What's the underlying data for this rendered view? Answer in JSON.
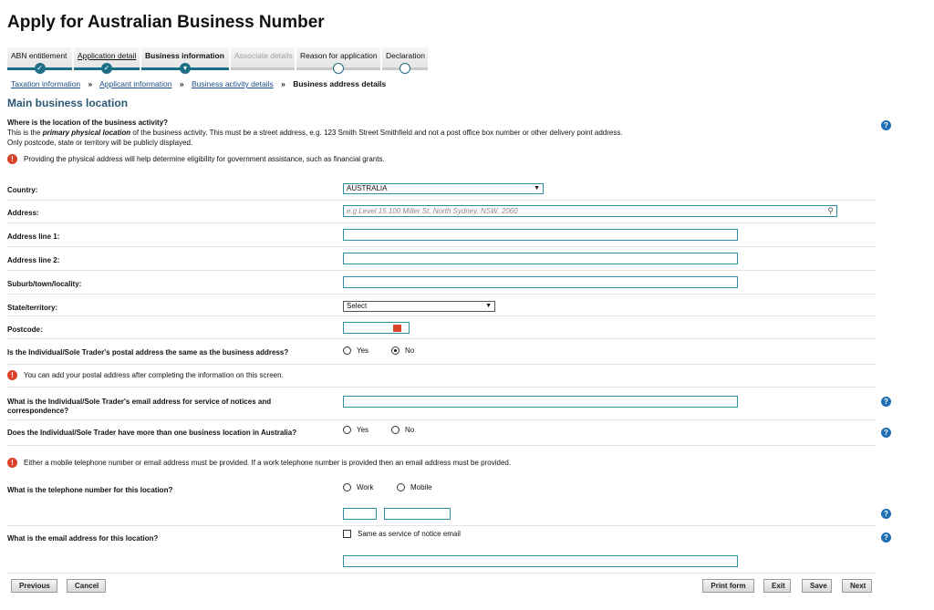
{
  "page_title": "Apply for Australian Business Number",
  "steps": [
    {
      "label": "ABN entitlement",
      "state": "complete"
    },
    {
      "label": "Application detail",
      "state": "complete"
    },
    {
      "label": "Business information",
      "state": "current"
    },
    {
      "label": "Associate details",
      "state": "disabled"
    },
    {
      "label": "Reason for application",
      "state": "pending"
    },
    {
      "label": "Declaration",
      "state": "pending"
    }
  ],
  "breadcrumb": {
    "items": [
      "Taxation information",
      "Applicant information",
      "Business activity details"
    ],
    "separator": "»",
    "current": "Business address details"
  },
  "section_heading": "Main business location",
  "intro": {
    "question": "Where is the location of the business activity?",
    "line1_pre": "This is the ",
    "line1_em": "primary physical location",
    "line1_post": " of the business activity. This must be a street address, e.g. 123 Smith Street Smithfield and not a post office box number or other delivery point address.",
    "line2": "Only postcode, state or territory will be publicly displayed."
  },
  "notices": {
    "physical_address": "Providing the physical address will help determine eligibility for government assistance, such as financial grants.",
    "postal_later": "You can add your postal address after completing the information on this screen.",
    "contact_required": "Either a mobile telephone number or email address must be provided. If a work telephone number is provided then an email address must be provided."
  },
  "fields": {
    "country": {
      "label": "Country:",
      "value": "AUSTRALIA"
    },
    "address": {
      "label": "Address:",
      "placeholder": "e.g Level 15 100 Miller St, North Sydney, NSW, 2060"
    },
    "address_line1": {
      "label": "Address line 1:",
      "value": ""
    },
    "address_line2": {
      "label": "Address line 2:",
      "value": ""
    },
    "suburb": {
      "label": "Suburb/town/locality:",
      "value": ""
    },
    "state": {
      "label": "State/territory:",
      "value": "Select"
    },
    "postcode": {
      "label": "Postcode:",
      "value": ""
    },
    "postal_same": {
      "label": "Is the Individual/Sole Trader's postal address the same as the business address?",
      "yes": "Yes",
      "no": "No",
      "selected": "No"
    },
    "notice_email": {
      "label_line1": "What is the Individual/Sole Trader's email address for service of notices and",
      "label_line2": "correspondence?",
      "value": ""
    },
    "multiple_locations": {
      "label": "Does the Individual/Sole Trader have more than one business location in Australia?",
      "yes": "Yes",
      "no": "No",
      "selected": ""
    },
    "telephone": {
      "label": "What is the telephone number for this location?",
      "work": "Work",
      "mobile": "Mobile",
      "area_code": "",
      "number": ""
    },
    "location_email": {
      "label": "What is the email address for this location?",
      "same_as_notice": "Same as service of notice email",
      "value": ""
    }
  },
  "buttons": {
    "previous": "Previous",
    "cancel": "Cancel",
    "print": "Print form",
    "exit": "Exit",
    "save": "Save",
    "next": "Next"
  },
  "icons": {
    "help": "?",
    "warning": "!",
    "check": "✓",
    "search": "⚲"
  },
  "colors": {
    "accent": "#1c6f86",
    "heading": "#2b5773",
    "warning": "#d9432c",
    "help": "#1f6fb5",
    "link": "#1d4e8a"
  }
}
